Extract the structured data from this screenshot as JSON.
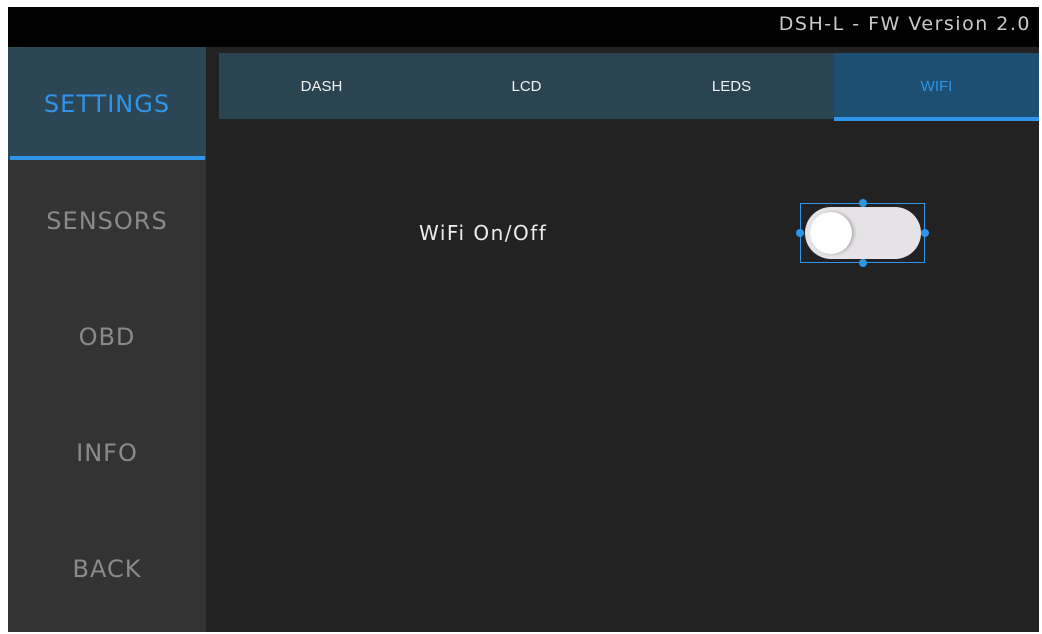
{
  "app": {
    "title": "DSH-L - FW Version 2.0"
  },
  "sidebar": {
    "items": [
      {
        "label": "SETTINGS",
        "active": true
      },
      {
        "label": "SENSORS",
        "active": false
      },
      {
        "label": "OBD",
        "active": false
      },
      {
        "label": "INFO",
        "active": false
      },
      {
        "label": "BACK",
        "active": false
      }
    ]
  },
  "tabs": [
    {
      "label": "DASH",
      "active": false
    },
    {
      "label": "LCD",
      "active": false
    },
    {
      "label": "LEDS",
      "active": false
    },
    {
      "label": "WIFI",
      "active": true
    }
  ],
  "wifi": {
    "label": "WiFi On/Off",
    "enabled": false
  },
  "colors": {
    "accent": "#2f95e8",
    "background": "#222222",
    "sidebar": "#333333",
    "tabbar": "#2b4452"
  }
}
